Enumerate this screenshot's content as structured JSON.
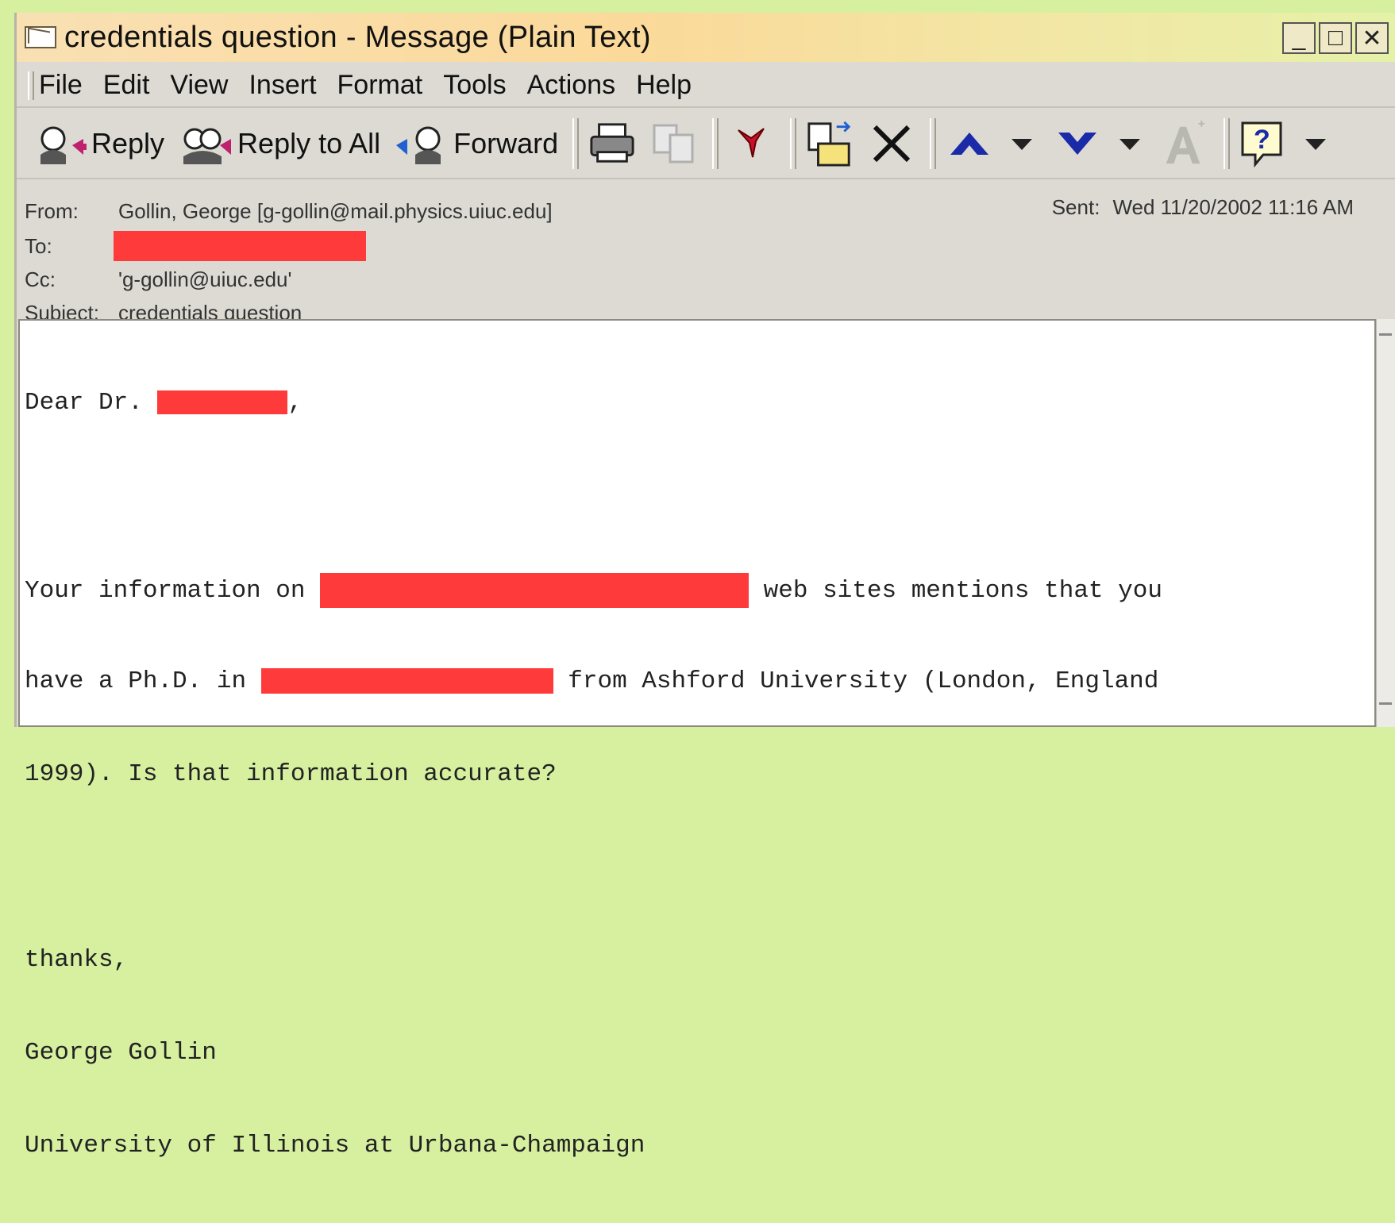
{
  "window": {
    "title": "credentials question - Message (Plain Text)",
    "controls": {
      "minimize": "_",
      "maximize": "□",
      "close": "✕"
    }
  },
  "menu": {
    "items": [
      {
        "label": "File"
      },
      {
        "label": "Edit"
      },
      {
        "label": "View"
      },
      {
        "label": "Insert"
      },
      {
        "label": "Format"
      },
      {
        "label": "Tools"
      },
      {
        "label": "Actions"
      },
      {
        "label": "Help"
      }
    ]
  },
  "toolbar": {
    "reply_label": "Reply",
    "reply_all_label": "Reply to All",
    "forward_label": "Forward",
    "icons": [
      "print-icon",
      "copy-icon",
      "flag-icon",
      "move-to-folder-icon",
      "delete-icon",
      "previous-item-icon",
      "next-item-icon",
      "font-size-icon",
      "help-icon"
    ]
  },
  "header": {
    "from_label": "From:",
    "from_value": "Gollin, George [g-gollin@mail.physics.uiuc.edu]",
    "to_label": "To:",
    "cc_label": "Cc:",
    "cc_value": "'g-gollin@uiuc.edu'",
    "subject_label": "Subject:",
    "subject_value": "credentials question",
    "sent_label": "Sent:",
    "sent_value": "Wed 11/20/2002 11:16 AM"
  },
  "body": {
    "line1_prefix": "Dear Dr. ",
    "line1_suffix": ",",
    "line2_prefix": "Your information on ",
    "line2_suffix": " web sites mentions that you",
    "line3_prefix": "have a Ph.D. in ",
    "line3_suffix": " from Ashford University (London, England",
    "line4": "1999). Is that information accurate?",
    "line5": "thanks,",
    "line6": "George Gollin",
    "line7": "University of Illinois at Urbana-Champaign"
  },
  "colors": {
    "redaction": "#ff3a3a",
    "background": "#d6f0a0"
  }
}
